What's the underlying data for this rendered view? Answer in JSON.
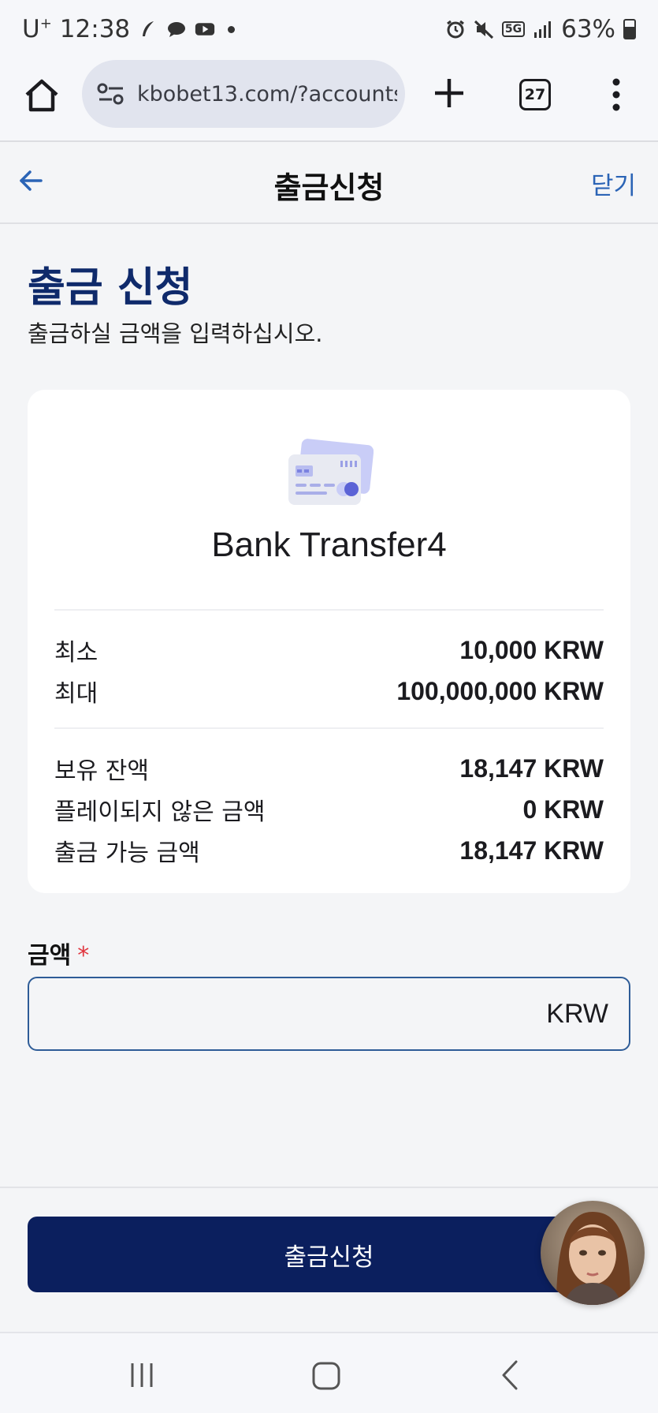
{
  "status_bar": {
    "carrier": "U",
    "carrier_sup": "+",
    "time": "12:38",
    "battery": "63%",
    "network": "5G"
  },
  "browser": {
    "url": "kbobet13.com/?accounts",
    "tab_count": "27"
  },
  "header": {
    "title": "출금신청",
    "close_label": "닫기"
  },
  "page": {
    "heading": "출금 신청",
    "subtitle": "출금하실 금액을 입력하십시오."
  },
  "method": {
    "name": "Bank Transfer4",
    "icon": "credit-card-icon"
  },
  "limits": [
    {
      "label": "최소",
      "value": "10,000 KRW"
    },
    {
      "label": "최대",
      "value": "100,000,000 KRW"
    }
  ],
  "balances": [
    {
      "label": "보유 잔액",
      "value": "18,147 KRW"
    },
    {
      "label": "플레이되지 않은 금액",
      "value": "0 KRW"
    },
    {
      "label": "출금 가능 금액",
      "value": "18,147 KRW"
    }
  ],
  "amount_field": {
    "label": "금액",
    "required_mark": "*",
    "value": "",
    "currency": "KRW"
  },
  "submit_label": "출금신청",
  "colors": {
    "heading": "#0f2a6b",
    "button": "#0b1f5e",
    "link": "#2b64b6",
    "required": "#e0363f",
    "input_border": "#2e5c97"
  }
}
